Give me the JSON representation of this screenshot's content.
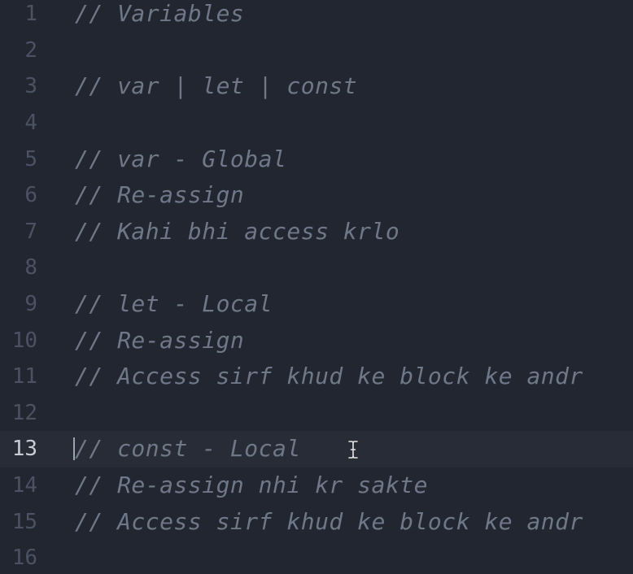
{
  "editor": {
    "active_line": 13,
    "lines": [
      {
        "number": "1",
        "text": "// Variables"
      },
      {
        "number": "2",
        "text": ""
      },
      {
        "number": "3",
        "text": "// var | let | const"
      },
      {
        "number": "4",
        "text": ""
      },
      {
        "number": "5",
        "text": "// var - Global"
      },
      {
        "number": "6",
        "text": "// Re-assign"
      },
      {
        "number": "7",
        "text": "// Kahi bhi access krlo"
      },
      {
        "number": "8",
        "text": ""
      },
      {
        "number": "9",
        "text": "// let - Local"
      },
      {
        "number": "10",
        "text": "// Re-assign"
      },
      {
        "number": "11",
        "text": "// Access sirf khud ke block ke andr"
      },
      {
        "number": "12",
        "text": ""
      },
      {
        "number": "13",
        "text": "// const - Local"
      },
      {
        "number": "14",
        "text": "// Re-assign nhi kr sakte"
      },
      {
        "number": "15",
        "text": "// Access sirf khud ke block ke andr"
      },
      {
        "number": "16",
        "text": ""
      }
    ]
  },
  "colors": {
    "background": "#222630",
    "active_line_bg": "#282c36",
    "line_number": "#4b5263",
    "active_line_number": "#c8ccd4",
    "comment": "#6f7888"
  },
  "cursor_icon": "text-cursor-icon"
}
